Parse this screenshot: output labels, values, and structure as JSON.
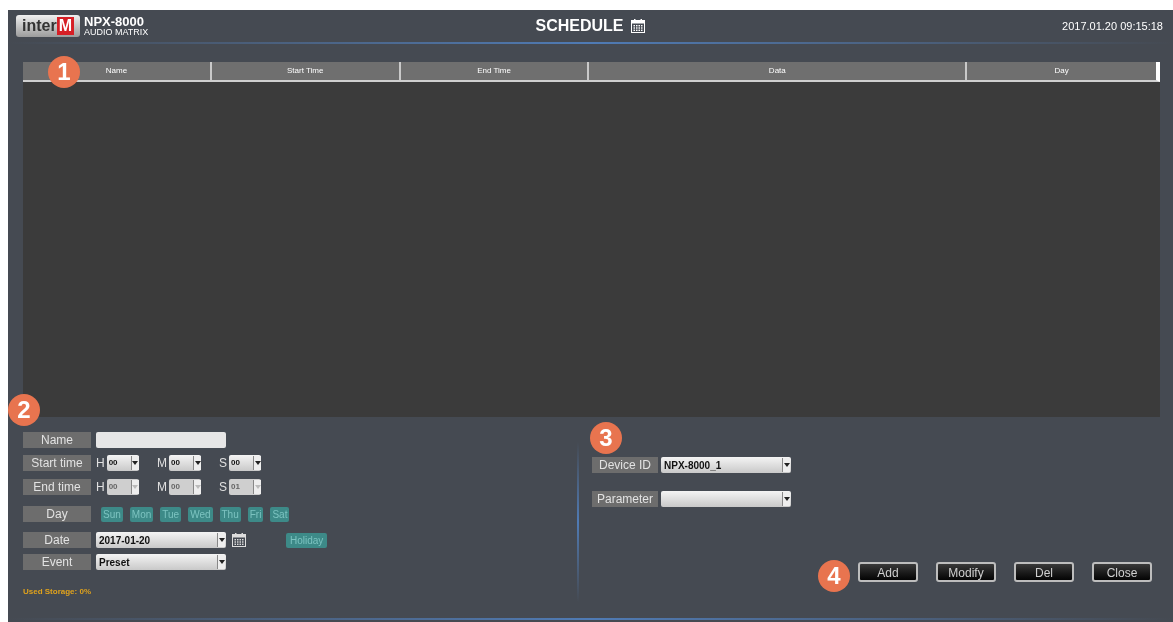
{
  "header": {
    "logo": {
      "part_1": "inter",
      "part_2": "M"
    },
    "product": "NPX-8000",
    "subtitle": "AUDIO MATRIX",
    "title": "SCHEDULE",
    "datetime": "2017.01.20 09:15:18"
  },
  "table": {
    "columns": [
      "Name",
      "Start Time",
      "End Time",
      "Data",
      "Day"
    ]
  },
  "form": {
    "name": {
      "label": "Name"
    },
    "start_time": {
      "label": "Start time",
      "disabled": false,
      "fields": [
        {
          "unit": "H",
          "value": "00"
        },
        {
          "unit": "M",
          "value": "00"
        },
        {
          "unit": "S",
          "value": "00"
        }
      ]
    },
    "end_time": {
      "label": "End time",
      "disabled": true,
      "fields": [
        {
          "unit": "H",
          "value": "00"
        },
        {
          "unit": "M",
          "value": "00"
        },
        {
          "unit": "S",
          "value": "01"
        }
      ]
    },
    "day": {
      "label": "Day",
      "days": [
        "Sun",
        "Mon",
        "Tue",
        "Wed",
        "Thu",
        "Fri",
        "Sat"
      ]
    },
    "date": {
      "label": "Date",
      "value": "2017-01-20",
      "holiday": "Holiday"
    },
    "event": {
      "label": "Event",
      "value": "Preset"
    },
    "storage": "Used Storage: 0%"
  },
  "device": {
    "device_id": {
      "label": "Device ID",
      "value": "NPX-8000_1"
    },
    "parameter": {
      "label": "Parameter"
    }
  },
  "buttons": [
    "Add",
    "Modify",
    "Del",
    "Close"
  ],
  "markers": [
    "1",
    "2",
    "3",
    "4"
  ]
}
